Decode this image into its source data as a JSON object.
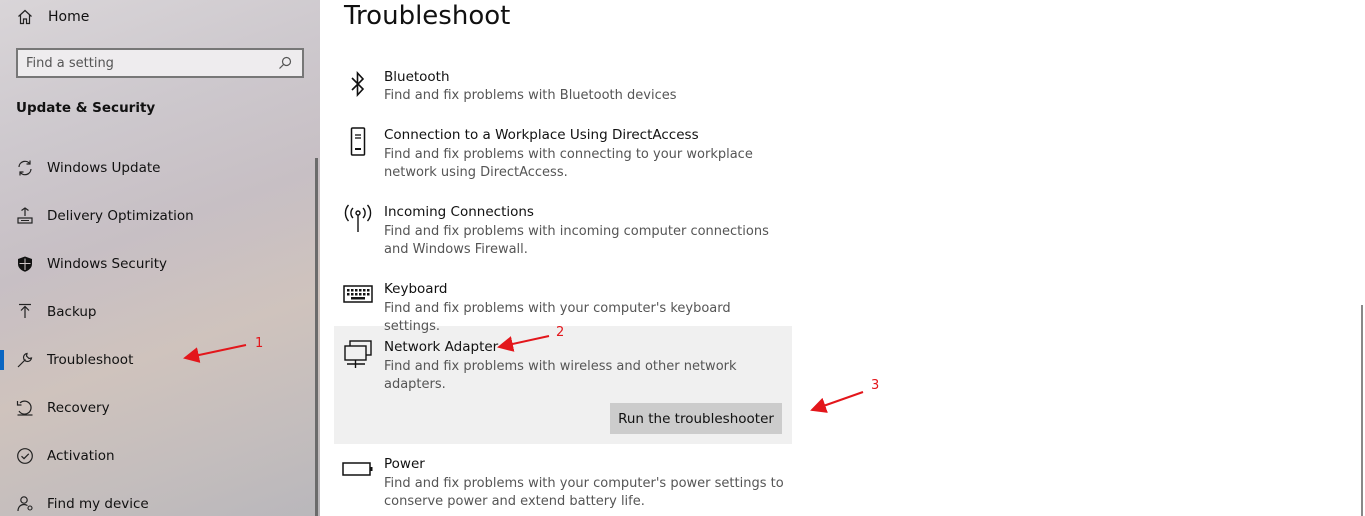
{
  "sidebar": {
    "home_label": "Home",
    "search": {
      "placeholder": "Find a setting"
    },
    "section_title": "Update & Security",
    "items": [
      {
        "label": "Windows Update",
        "icon": "sync-icon"
      },
      {
        "label": "Delivery Optimization",
        "icon": "delivery-optimization-icon"
      },
      {
        "label": "Windows Security",
        "icon": "shield-icon"
      },
      {
        "label": "Backup",
        "icon": "backup-arrow-icon"
      },
      {
        "label": "Troubleshoot",
        "icon": "wrench-icon",
        "active": true
      },
      {
        "label": "Recovery",
        "icon": "recovery-icon"
      },
      {
        "label": "Activation",
        "icon": "checkmark-circle-icon"
      },
      {
        "label": "Find my device",
        "icon": "person-location-icon"
      }
    ]
  },
  "main": {
    "title": "Troubleshoot",
    "items": [
      {
        "name": "Bluetooth",
        "desc": "Find and fix problems with Bluetooth devices",
        "icon": "bluetooth-icon"
      },
      {
        "name": "Connection to a Workplace Using DirectAccess",
        "desc": "Find and fix problems with connecting to your workplace network using DirectAccess.",
        "icon": "phone-device-icon"
      },
      {
        "name": "Incoming Connections",
        "desc": "Find and fix problems with incoming computer connections and Windows Firewall.",
        "icon": "antenna-icon"
      },
      {
        "name": "Keyboard",
        "desc": "Find and fix problems with your computer's keyboard settings.",
        "icon": "keyboard-icon"
      },
      {
        "name": "Network Adapter",
        "desc": "Find and fix problems with wireless and other network adapters.",
        "icon": "network-adapter-icon",
        "selected": true
      },
      {
        "name": "Power",
        "desc": "Find and fix problems with your computer's power settings to conserve power and extend battery life.",
        "icon": "battery-icon"
      }
    ],
    "run_button": "Run the troubleshooter"
  },
  "annotations": {
    "colors": {
      "arrow": "#e3161b"
    },
    "labels": [
      "1",
      "2",
      "3"
    ]
  }
}
